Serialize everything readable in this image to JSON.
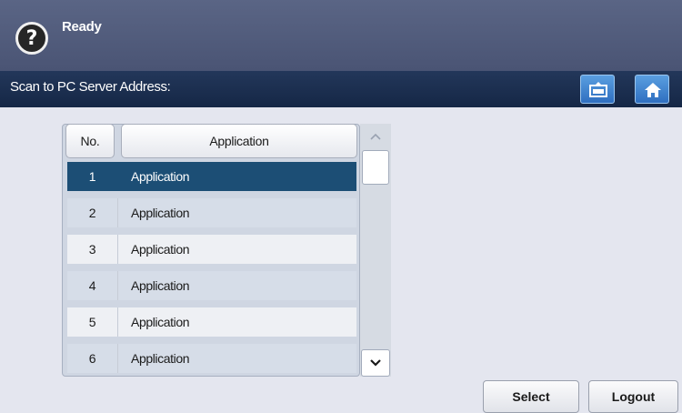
{
  "header": {
    "status": "Ready",
    "help_icon_glyph": "?",
    "help_icon": "help-question-icon"
  },
  "title_bar": {
    "title": "Scan to PC Server Address:",
    "buttons": [
      {
        "icon": "tray-upload-icon"
      },
      {
        "icon": "home-icon"
      }
    ]
  },
  "table": {
    "columns": [
      "No.",
      "Application"
    ],
    "rows": [
      {
        "no": "1",
        "application": "Application",
        "selected": true
      },
      {
        "no": "2",
        "application": "Application",
        "selected": false
      },
      {
        "no": "3",
        "application": "Application",
        "selected": false
      },
      {
        "no": "4",
        "application": "Application",
        "selected": false
      },
      {
        "no": "5",
        "application": "Application",
        "selected": false
      },
      {
        "no": "6",
        "application": "Application",
        "selected": false
      }
    ]
  },
  "scrollbar": {
    "up_icon": "chevron-up-icon",
    "down_icon": "chevron-down-icon"
  },
  "footer": {
    "select_label": "Select",
    "logout_label": "Logout"
  },
  "colors": {
    "header_bg": "#4f5a7a",
    "title_bar_bg": "#1c2e4f",
    "selected_row": "#1c4e75",
    "accent_button": "#3f84d0",
    "page_bg": "#e4e6ef"
  }
}
